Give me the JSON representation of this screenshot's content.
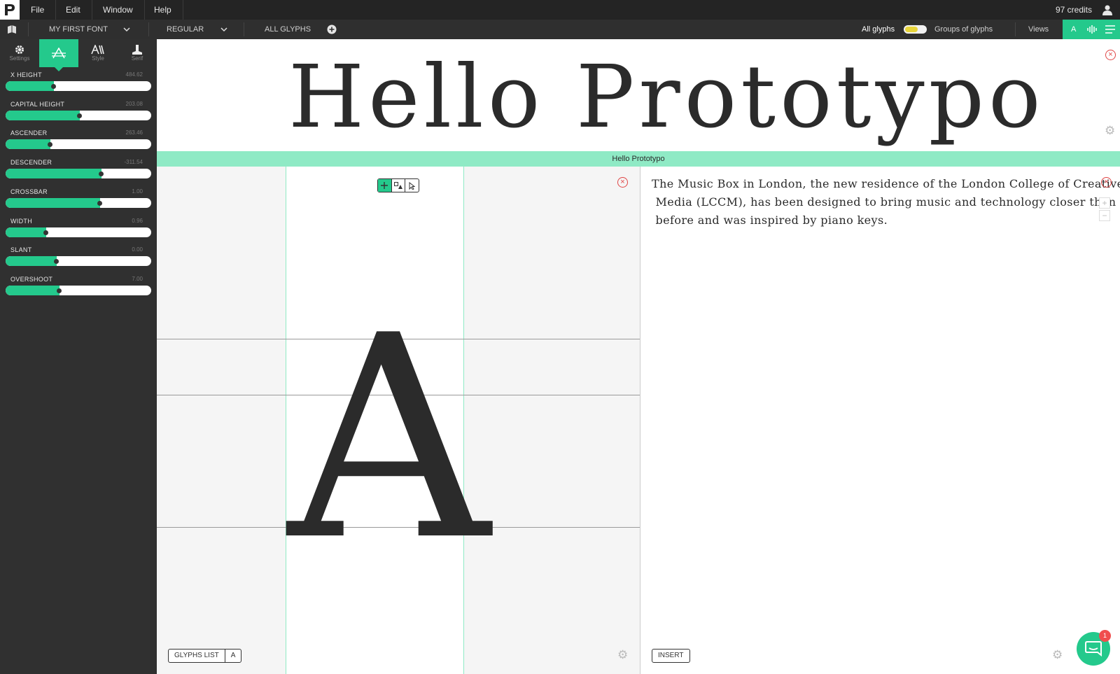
{
  "menubar": {
    "items": [
      "File",
      "Edit",
      "Window",
      "Help"
    ],
    "credits": "97 credits"
  },
  "toolbar": {
    "font_name": "MY FIRST FONT",
    "variant": "REGULAR",
    "glyph_scope": "ALL GLYPHS",
    "all_glyphs_label": "All glyphs",
    "groups_label": "Groups of glyphs",
    "views_label": "Views",
    "views_active": "A"
  },
  "sidebar": {
    "tabs": [
      {
        "label": "Settings",
        "icon": "gear-icon"
      },
      {
        "label": "",
        "icon": "struck-a-icon"
      },
      {
        "label": "Style",
        "icon": "style-icon"
      },
      {
        "label": "Serif",
        "icon": "serif-icon"
      }
    ],
    "params": [
      {
        "name": "X HEIGHT",
        "value": "484.62",
        "level": 0.33
      },
      {
        "name": "CAPITAL HEIGHT",
        "value": "203.08",
        "level": 0.51
      },
      {
        "name": "ASCENDER",
        "value": "263.46",
        "level": 0.31
      },
      {
        "name": "DESCENDER",
        "value": "-311.54",
        "level": 0.66
      },
      {
        "name": "CROSSBAR",
        "value": "1.00",
        "level": 0.65
      },
      {
        "name": "WIDTH",
        "value": "0.96",
        "level": 0.28
      },
      {
        "name": "SLANT",
        "value": "0.00",
        "level": 0.35
      },
      {
        "name": "OVERSHOOT",
        "value": "7.00",
        "level": 0.37
      }
    ]
  },
  "preview": {
    "text": "Hello Prototypo",
    "strip_label": "Hello Prototypo"
  },
  "glyph_view": {
    "glyph": "A",
    "glyphs_list_label": "GLYPHS LIST",
    "current_glyph": "A"
  },
  "text_view": {
    "body": "The Music Box in London, the new residence of the London College of Creative\n Media (LCCM), has been designed to bring music and technology closer than ev\n before and was inspired by piano keys.",
    "insert_label": "INSERT"
  },
  "chat": {
    "badge_count": "1"
  },
  "colors": {
    "accent": "#24c98c",
    "accent_light": "#8feac5",
    "sidebar_bg": "#303030",
    "menubar_bg": "#242424",
    "close_red": "#e04545",
    "toggle_yellow": "#e8d53b"
  }
}
